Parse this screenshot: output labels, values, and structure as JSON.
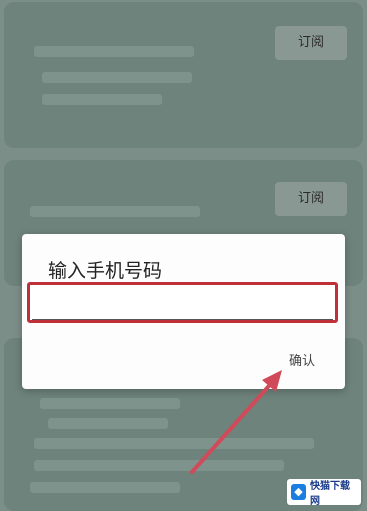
{
  "background": {
    "subscribe_label_1": "订阅",
    "subscribe_label_2": "订阅"
  },
  "dialog": {
    "title": "输入手机号码",
    "input_value": "",
    "input_placeholder": "",
    "confirm_label": "确认"
  },
  "watermark": {
    "icon": "logo-mark-icon",
    "text": "快猫下载网"
  },
  "colors": {
    "overlay": "#7c8e88",
    "card": "#6d837b",
    "highlight_border": "#c0303a",
    "arrow": "#d04a5a",
    "logo_blue": "#1a7fe0"
  }
}
